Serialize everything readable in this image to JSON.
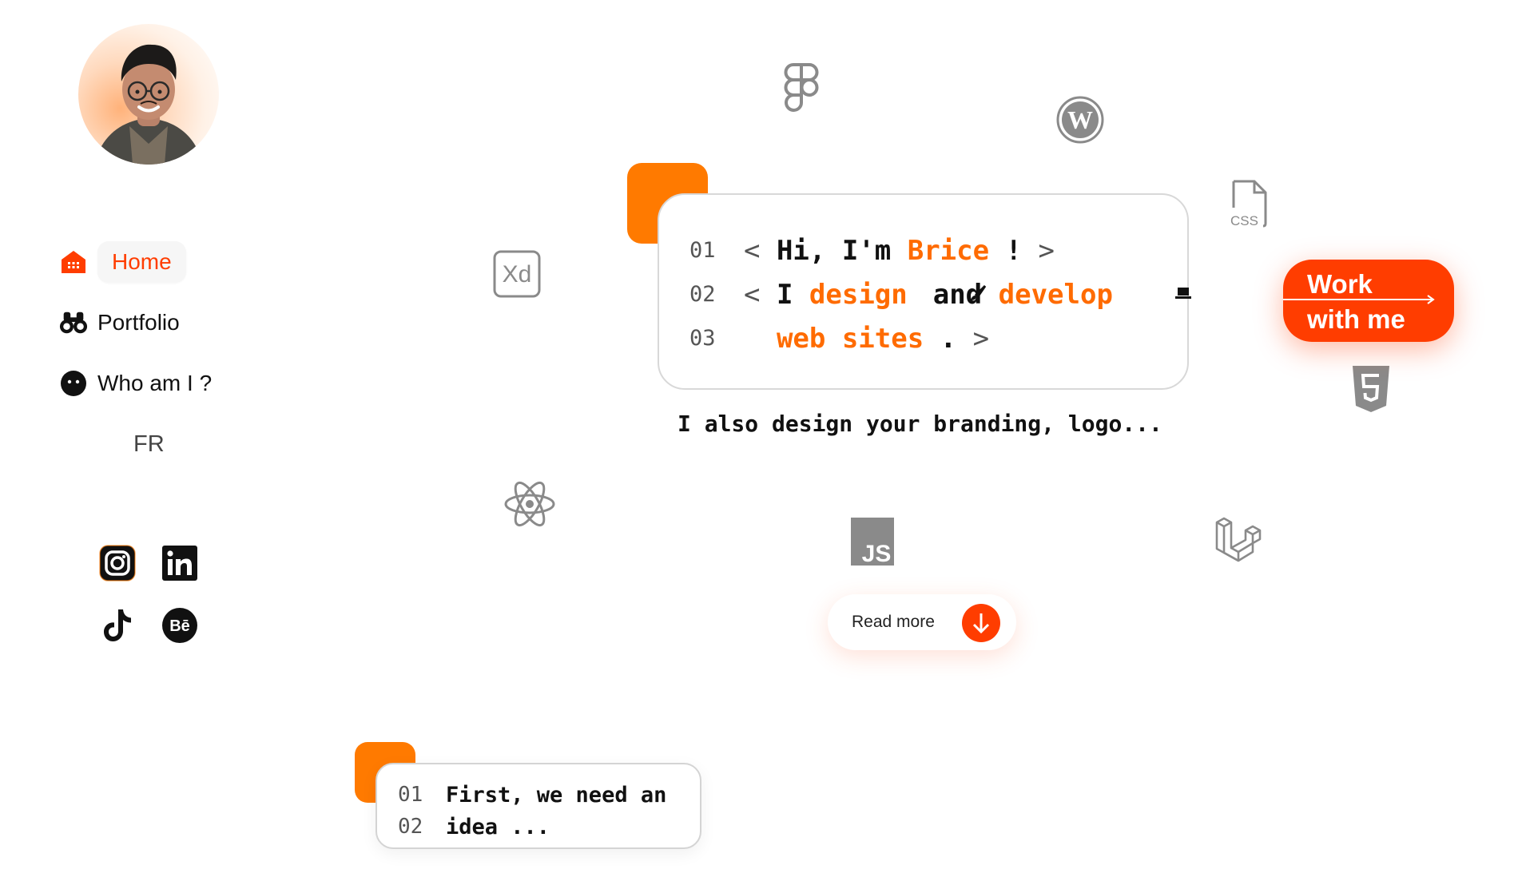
{
  "sidebar": {
    "nav": [
      {
        "label": "Home",
        "icon": "home-icon",
        "active": true
      },
      {
        "label": "Portfolio",
        "icon": "binoculars-icon"
      },
      {
        "label": "Who am I ?",
        "icon": "face-icon"
      }
    ],
    "lang": "FR",
    "social": [
      "instagram-icon",
      "linkedin-icon",
      "tiktok-icon",
      "behance-icon"
    ]
  },
  "hero": {
    "lines": [
      {
        "num": "01",
        "parts": [
          "Hi, I'm ",
          "Brice",
          " !"
        ]
      },
      {
        "num": "02",
        "parts": [
          "I ",
          "design",
          "and",
          "develop"
        ]
      },
      {
        "num": "03",
        "parts": [
          "web sites",
          "."
        ]
      }
    ],
    "subtitle": "I also design your branding, logo..."
  },
  "cta": {
    "work_line1": "Work",
    "work_line2": "with me",
    "read_more": "Read more"
  },
  "idea_card": {
    "lines": [
      {
        "num": "01",
        "text": "First, we need an"
      },
      {
        "num": "02",
        "highlight": "idea",
        "text": " ..."
      }
    ]
  },
  "tech_icons": [
    "figma-icon",
    "wordpress-icon",
    "css-icon",
    "xd-icon",
    "html5-icon",
    "react-icon",
    "js-icon",
    "laravel-icon"
  ],
  "colors": {
    "accent": "#ff3d00",
    "orange": "#ff7a00",
    "icon_gray": "#8a8a8a"
  }
}
